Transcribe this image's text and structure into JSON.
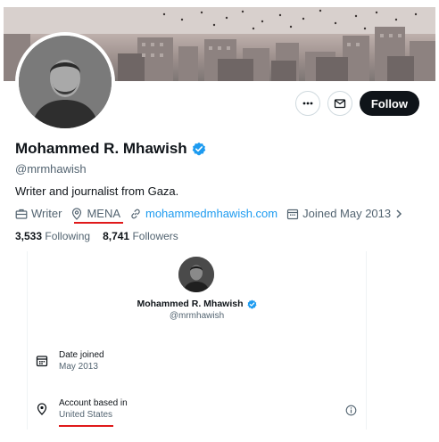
{
  "profile": {
    "display_name": "Mohammed R. Mhawish",
    "handle": "@mrmhawish",
    "bio": "Writer and journalist from Gaza.",
    "meta": {
      "profession": "Writer",
      "location": "MENA",
      "website": "mohammedmhawish.com",
      "joined": "Joined May 2013"
    },
    "following_count": "3,533",
    "following_label": "Following",
    "followers_count": "8,741",
    "followers_label": "Followers",
    "follow_button": "Follow",
    "verified_color": "#1d9bf0"
  },
  "about": {
    "display_name": "Mohammed R. Mhawish",
    "handle": "@mrmhawish",
    "date_joined_label": "Date joined",
    "date_joined_value": "May 2013",
    "account_based_label": "Account based in",
    "account_based_value": "United States"
  },
  "icons": [
    "more-icon",
    "message-icon",
    "briefcase-icon",
    "location-pin-icon",
    "link-icon",
    "calendar-icon",
    "chevron-right-icon",
    "verified-badge-icon",
    "info-icon"
  ],
  "annotation_color": "#e0191a"
}
